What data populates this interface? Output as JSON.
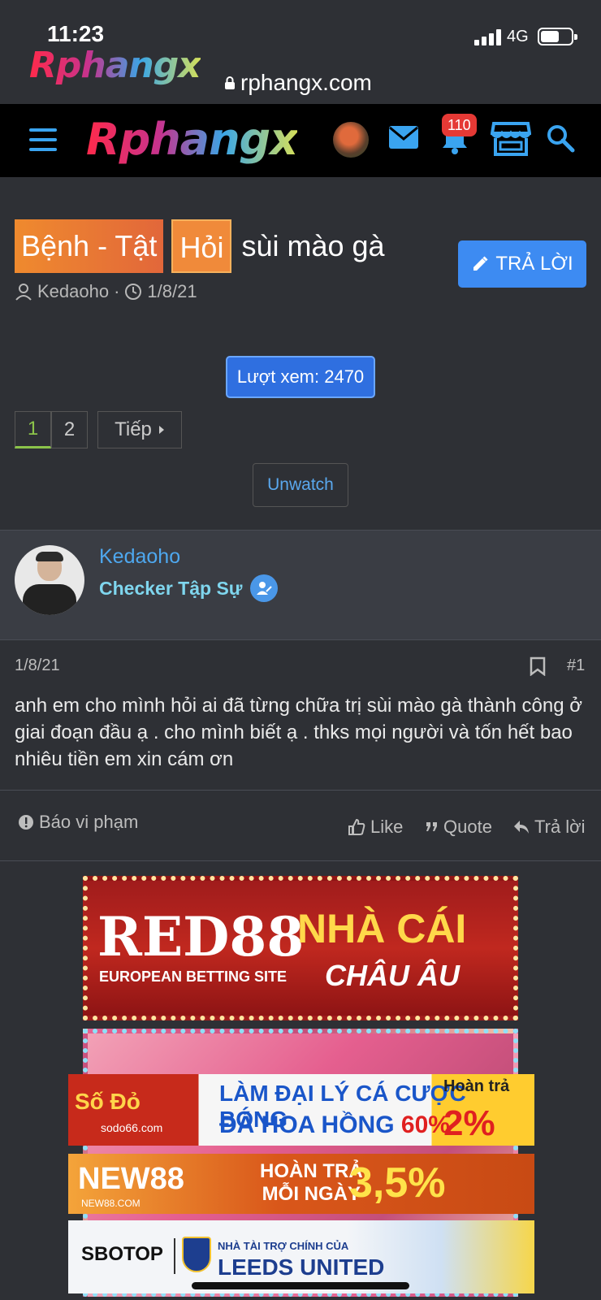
{
  "status_bar": {
    "time": "11:23",
    "network": "4G"
  },
  "browser": {
    "url": "rphangx.com",
    "mini_logo": "Rphangx"
  },
  "site": {
    "logo": "Rphangx",
    "notification_count": "110"
  },
  "thread": {
    "prefixes": [
      "Bệnh - Tật",
      "Hỏi"
    ],
    "title": "sùi mào gà",
    "author": "Kedaoho",
    "date": "1/8/21",
    "reply_label": "TRẢ LỜI",
    "views_label": "Lượt xem: 2470"
  },
  "pagination": {
    "pages": [
      "1",
      "2"
    ],
    "next_label": "Tiếp"
  },
  "unwatch_label": "Unwatch",
  "post": {
    "username": "Kedaoho",
    "user_title": "Checker Tập Sự",
    "date": "1/8/21",
    "number": "#1",
    "body": "anh em cho mình hỏi ai đã từng chữa trị sùi mào gà thành công ở giai đoạn đầu ạ . cho mình biết ạ . thks mọi người và tốn hết bao nhiêu tiền em xin cám ơn",
    "actions": {
      "report": "Báo vi phạm",
      "like": "Like",
      "quote": "Quote",
      "reply": "Trả lời"
    }
  },
  "ads": {
    "red88": {
      "brand": "RED88",
      "sub": "EUROPEAN BETTING SITE",
      "headline": "NHÀ CÁI",
      "headline2": "CHÂU ÂU"
    },
    "sodo": {
      "brand": "Số Đỏ",
      "domain": "sodo66.com",
      "line1": "LÀM ĐẠI LÝ CÁ CƯỢC BÓNG",
      "line2": "ĐÁ HOA HỒNG",
      "line2_pct": "60%",
      "cashback": "Hoàn trả",
      "cashback_pct": "2%"
    },
    "new88": {
      "brand": "NEW88",
      "domain": "NEW88.COM",
      "line1": "HOÀN TRẢ",
      "line2": "MỖI NGÀY",
      "pct": "3,5%"
    },
    "sbotop": {
      "brand": "SBOTOP",
      "small": "NHÀ TÀI TRỢ CHÍNH CỦA",
      "big": "LEEDS UNITED"
    }
  },
  "colors": {
    "accent_blue": "#3d8bf2",
    "link_blue": "#4ea8ef",
    "user_title": "#7fd6ee",
    "active_page": "#8bc34a",
    "background": "#2e3035"
  }
}
